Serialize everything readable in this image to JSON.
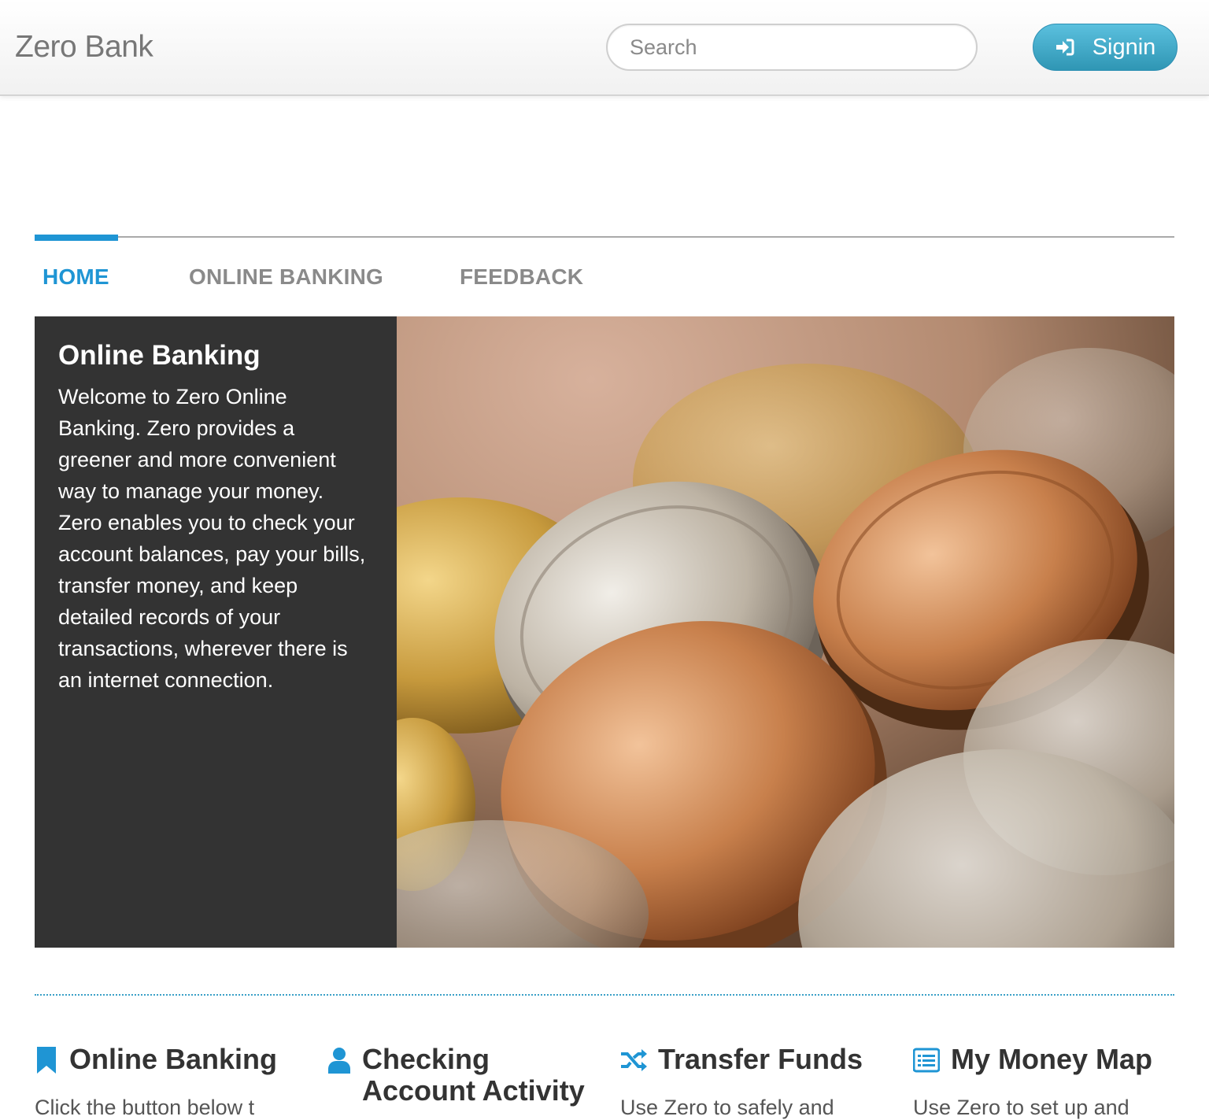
{
  "header": {
    "brand": "Zero Bank",
    "search_placeholder": "Search",
    "signin_label": "Signin"
  },
  "tabs": [
    {
      "label": "HOME",
      "active": true
    },
    {
      "label": "ONLINE BANKING",
      "active": false
    },
    {
      "label": "FEEDBACK",
      "active": false
    }
  ],
  "hero": {
    "title": "Online Banking",
    "text": "Welcome to Zero Online Banking. Zero provides a greener and more convenient way to manage your money. Zero enables you to check your account balances, pay your bills, transfer money, and keep detailed records of your transactions, wherever there is an internet connection."
  },
  "features": [
    {
      "title": "Online Banking",
      "icon": "bookmark-icon",
      "text": "Click the button below t"
    },
    {
      "title": "Checking Account Activity",
      "icon": "user-icon",
      "text": ""
    },
    {
      "title": "Transfer Funds",
      "icon": "shuffle-icon",
      "text": "Use Zero to safely and"
    },
    {
      "title": "My Money Map",
      "icon": "list-icon",
      "text": "Use Zero to set up and"
    }
  ],
  "colors": {
    "accent": "#1f95d4",
    "signin_button": "#3ca5cb",
    "hero_panel": "#333333"
  }
}
